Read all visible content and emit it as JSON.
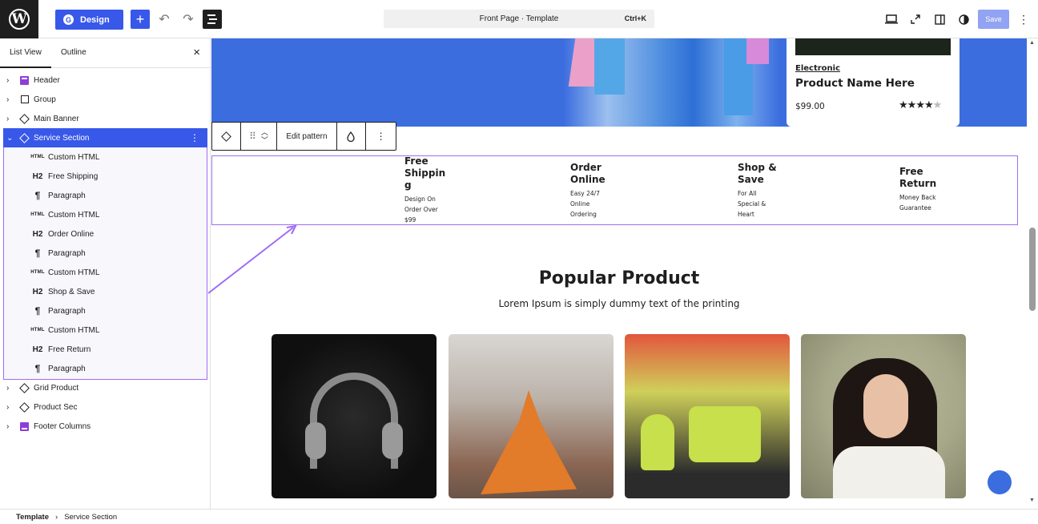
{
  "topbar": {
    "design_label": "Design",
    "command_title": "Front Page · Template",
    "command_shortcut": "Ctrl+K",
    "save_label": "Save"
  },
  "sidebar": {
    "tab_list_view": "List View",
    "tab_outline": "Outline",
    "items": [
      {
        "label": "Header",
        "icon": "template-part-header-icon"
      },
      {
        "label": "Group",
        "icon": "group-icon"
      },
      {
        "label": "Main Banner",
        "icon": "pattern-icon"
      },
      {
        "label": "Service Section",
        "icon": "pattern-icon"
      },
      {
        "label": "Custom HTML",
        "icon": "html-icon"
      },
      {
        "label": "Free Shipping",
        "icon": "heading-h2-icon"
      },
      {
        "label": "Paragraph",
        "icon": "paragraph-icon"
      },
      {
        "label": "Custom HTML",
        "icon": "html-icon"
      },
      {
        "label": "Order Online",
        "icon": "heading-h2-icon"
      },
      {
        "label": "Paragraph",
        "icon": "paragraph-icon"
      },
      {
        "label": "Custom HTML",
        "icon": "html-icon"
      },
      {
        "label": "Shop & Save",
        "icon": "heading-h2-icon"
      },
      {
        "label": "Paragraph",
        "icon": "paragraph-icon"
      },
      {
        "label": "Custom HTML",
        "icon": "html-icon"
      },
      {
        "label": "Free Return",
        "icon": "heading-h2-icon"
      },
      {
        "label": "Paragraph",
        "icon": "paragraph-icon"
      },
      {
        "label": "Grid Product",
        "icon": "pattern-icon"
      },
      {
        "label": "Product Sec",
        "icon": "pattern-icon"
      },
      {
        "label": "Footer Columns",
        "icon": "template-part-footer-icon"
      }
    ],
    "icon_text": {
      "html": "HTML",
      "h2": "H2",
      "paragraph": "¶"
    }
  },
  "canvas": {
    "product": {
      "category": "Electronic",
      "name": "Product Name Here",
      "price": "$99.00",
      "rating": 4,
      "rating_max": 5
    },
    "block_toolbar": {
      "edit_pattern": "Edit pattern"
    },
    "services": [
      {
        "title": "Free Shipping",
        "title_display": [
          "Free",
          "Shippin",
          "g"
        ],
        "desc": [
          "Design On",
          "Order Over",
          "$99"
        ]
      },
      {
        "title": "Order Online",
        "title_display": [
          "Order",
          "Online"
        ],
        "desc": [
          "Easy 24/7",
          "Online",
          "Ordering"
        ]
      },
      {
        "title": "Shop & Save",
        "title_display": [
          "Shop &",
          "Save"
        ],
        "desc": [
          "For All",
          "Special &",
          "Heart"
        ]
      },
      {
        "title": "Free Return",
        "title_display": [
          "Free",
          "Return"
        ],
        "desc": [
          "Money Back",
          "Guarantee"
        ]
      }
    ],
    "popular_title": "Popular Product",
    "popular_subtitle": "Lorem Ipsum is simply dummy text of the printing"
  },
  "footer": {
    "crumbs": [
      "Template",
      "Service Section"
    ]
  },
  "colors": {
    "wp_blue": "#3858e9",
    "banner_blue": "#3b6ddf",
    "selection_purple": "#9f6bf5"
  }
}
